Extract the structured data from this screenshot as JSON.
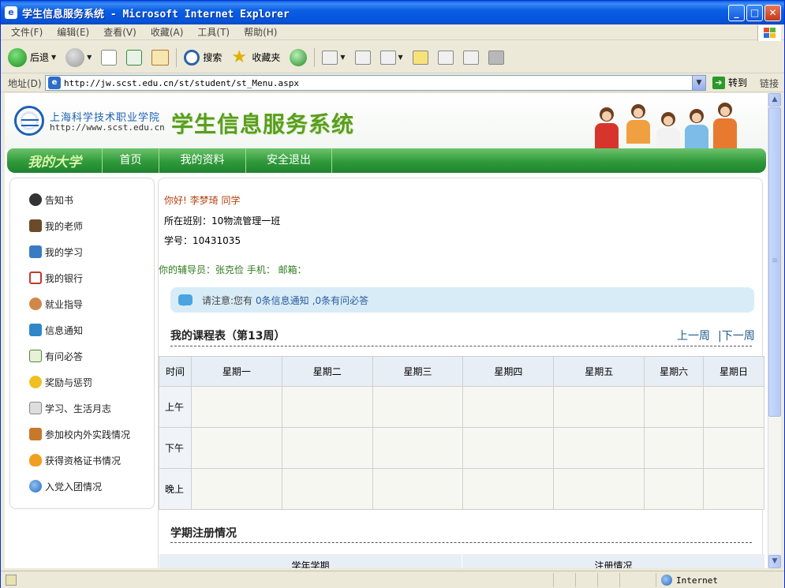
{
  "window": {
    "title": "学生信息服务系统 - Microsoft Internet Explorer",
    "controls": [
      "_",
      "□",
      "✕"
    ]
  },
  "menu": [
    "文件(F)",
    "编辑(E)",
    "查看(V)",
    "收藏(A)",
    "工具(T)",
    "帮助(H)"
  ],
  "toolbar": {
    "back": "后退",
    "search": "搜索",
    "favorites": "收藏夹"
  },
  "address": {
    "label": "地址(D)",
    "url": "http://jw.scst.edu.cn/st/student/st_Menu.aspx",
    "go": "转到",
    "links": "链接"
  },
  "status": {
    "zone": "Internet"
  },
  "site": {
    "school_name": "上海科学技术职业学院",
    "school_url": "http://www.scst.edu.cn",
    "system_title": "学生信息服务系统"
  },
  "nav": {
    "brand": "我的大学",
    "items": [
      "首页",
      "我的资料",
      "安全退出"
    ]
  },
  "sidebar": {
    "items": [
      {
        "label": "告知书",
        "icon": "headset-icon",
        "color": "#333333"
      },
      {
        "label": "我的老师",
        "icon": "teacher-icon",
        "color": "#6b4a2a"
      },
      {
        "label": "我的学习",
        "icon": "book-icon",
        "color": "#3a7cc4"
      },
      {
        "label": "我的银行",
        "icon": "calendar-icon",
        "color": "#c0392b"
      },
      {
        "label": "就业指导",
        "icon": "person-icon",
        "color": "#d0884a"
      },
      {
        "label": "信息通知",
        "icon": "screen-icon",
        "color": "#2f87c8"
      },
      {
        "label": "有问必答",
        "icon": "open-book-icon",
        "color": "#4a8a3a"
      },
      {
        "label": "奖励与惩罚",
        "icon": "star-icon",
        "color": "#f0c020"
      },
      {
        "label": "学习、生活月志",
        "icon": "calculator-icon",
        "color": "#888888"
      },
      {
        "label": "参加校内外实践情况",
        "icon": "handshake-icon",
        "color": "#c8782a"
      },
      {
        "label": "获得资格证书情况",
        "icon": "lightbulb-icon",
        "color": "#f0a020"
      },
      {
        "label": "入党入团情况",
        "icon": "globe-icon",
        "color": "#2a6ac0"
      }
    ]
  },
  "student": {
    "greeting": "你好! 李梦琦 同学",
    "class_line": "所在班别：10物流管理一班",
    "id_line": "学号：10431035",
    "advisor_line": "你的辅导员：张克俭   手机：       邮箱："
  },
  "notice": {
    "prefix": "请注意:您有",
    "info": "0条信息通知",
    "qa": ",0条有问必答"
  },
  "schedule": {
    "title": "我的课程表（第13周）",
    "prev_week": "上一周",
    "next_week": "|下一周",
    "columns": [
      "时间",
      "星期一",
      "星期二",
      "星期三",
      "星期四",
      "星期五",
      "星期六",
      "星期日"
    ],
    "rows": [
      "上午",
      "下午",
      "晚上"
    ]
  },
  "registration": {
    "title": "学期注册情况",
    "columns": [
      "学年学期",
      "注册情况"
    ]
  }
}
